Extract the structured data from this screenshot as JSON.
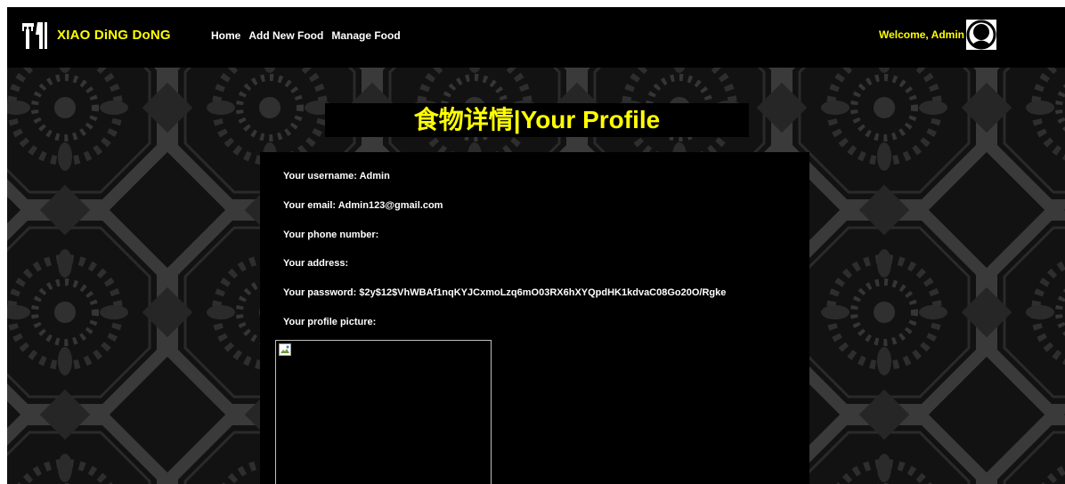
{
  "navbar": {
    "brand": "XIAO DiNG DoNG",
    "links": [
      "Home",
      "Add New Food",
      "Manage Food"
    ],
    "welcome": "Welcome, Admin",
    "logo_icon": "fork-knife-icon",
    "avatar_icon": "user-avatar-icon"
  },
  "page": {
    "title": "食物详情|Your Profile"
  },
  "profile": {
    "username": "Your username: Admin",
    "email": "Your email: Admin123@gmail.com",
    "phone": "Your phone number:",
    "address": "Your address:",
    "password": "Your password: $2y$12$VhWBAf1nqKYJCxmoLzq6mO03RX6hXYQpdHK1kdvaC08Go20O/Rgke",
    "picture": "Your profile picture:"
  },
  "colors": {
    "accent": "#ffff00",
    "navbar_bg": "#000000",
    "panel_bg": "#000000",
    "text": "#ffffff"
  }
}
